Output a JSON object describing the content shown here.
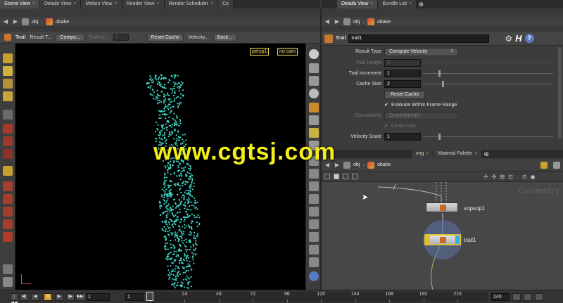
{
  "left_tabs": [
    {
      "label": "Scene View",
      "active": true
    },
    {
      "label": "Details View",
      "active": false
    },
    {
      "label": "Motion View",
      "active": false
    },
    {
      "label": "Render View",
      "active": false
    },
    {
      "label": "Render Scheduler",
      "active": false
    },
    {
      "label": "Co",
      "active": false
    }
  ],
  "right_tabs": [
    {
      "label": "Details View",
      "active": true
    },
    {
      "label": "Bundle List",
      "active": false
    }
  ],
  "left_path": {
    "root": "obj",
    "node": "obake"
  },
  "right_path": {
    "root": "obj",
    "node": "obake"
  },
  "viewport_toolbar": {
    "node_type": "Trail",
    "result_label": "Result T...",
    "result_value": "Compu...",
    "trail_label": "Trail Le...",
    "trail_value": "2",
    "reset_cache": "Reset Cache",
    "velocity_label": "Velocity...",
    "velocity_value": "Back..."
  },
  "viewport": {
    "camera_view": "persp1",
    "camera": "no cam"
  },
  "params_header": {
    "node_type": "Trail",
    "node_name": "trail1",
    "help_icon": "?"
  },
  "params": {
    "result_type_label": "Result Type",
    "result_type_value": "Compute Velocity",
    "trail_length_label": "Trail Length",
    "trail_length_value": "2",
    "trail_increment_label": "Trail Increment",
    "trail_increment_value": "1",
    "trail_increment_fraction": 0.12,
    "cache_size_label": "Cache Size",
    "cache_size_value": "2",
    "cache_size_fraction": 0.15,
    "reset_cache": "Reset Cache",
    "evaluate_label": "Evaluate Within Frame Range",
    "connectivity_label": "Connectivity",
    "connectivity_value": "Quadrilaterals",
    "close_rows_label": "Close rows",
    "velocity_scale_label": "Velocity Scale",
    "velocity_scale_value": "1",
    "velocity_scale_fraction": 0.12
  },
  "network_tabs": [
    {
      "label": "img",
      "active": false
    },
    {
      "label": "Material Palette",
      "active": false
    }
  ],
  "network": {
    "context_label": "Geometry",
    "nodes": [
      {
        "name": "vopsop1"
      },
      {
        "name": "trail1"
      }
    ]
  },
  "timeline": {
    "current_frame": "1",
    "start_frame": "1",
    "end_frame": "240",
    "ticks": [
      "1",
      "24",
      "48",
      "72",
      "96",
      "120",
      "144",
      "168",
      "192",
      "216"
    ]
  },
  "watermark": "www.cgtsj.com",
  "colors": {
    "points": "#3fd6c4",
    "accent_orange": "#e07a20",
    "camera_yellow": "#e8d44d",
    "watermark": "#f2ee1a"
  }
}
